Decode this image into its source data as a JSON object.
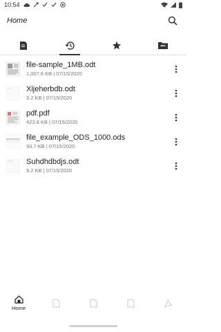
{
  "status_bar": {
    "time": "10:54",
    "icons": [
      "cloud-icon",
      "vpn-key-icon",
      "check-icon",
      "check-icon",
      "circle-a-icon"
    ],
    "right_icons": [
      "wifi-icon",
      "signal-icon",
      "battery-icon"
    ]
  },
  "app_bar": {
    "title": "Home",
    "search_icon": "search-icon"
  },
  "tabs": [
    {
      "name": "tab-browse",
      "icon": "document-icon",
      "active": false
    },
    {
      "name": "tab-recent",
      "icon": "history-icon",
      "active": true
    },
    {
      "name": "tab-favorites",
      "icon": "star-icon",
      "active": false
    },
    {
      "name": "tab-folder",
      "icon": "folder-icon",
      "active": false
    }
  ],
  "files": [
    {
      "name": "file-sample_1MB.odt",
      "meta": "1,007.6 KB | 07/15/2020",
      "thumb": "document-thumbnail"
    },
    {
      "name": "Xijeherbdb.odt",
      "meta": "9.2 KB | 07/15/2020",
      "thumb": "blank-document-thumbnail"
    },
    {
      "name": "pdf.pdf",
      "meta": "423.8 KB | 07/15/2020",
      "thumb": "pdf-thumbnail"
    },
    {
      "name": "file_example_ODS_1000.ods",
      "meta": "93.7 KB | 07/15/2020",
      "thumb": "spreadsheet-thumbnail"
    },
    {
      "name": "Suhdhdbdjs.odt",
      "meta": "9.2 KB | 07/15/2020",
      "thumb": "blank-document-thumbnail"
    }
  ],
  "bottom_nav": [
    {
      "label": "Home",
      "icon": "home-icon",
      "active": true
    },
    {
      "label": "",
      "icon": "document-icon",
      "active": false
    },
    {
      "label": "",
      "icon": "document-icon",
      "active": false
    },
    {
      "label": "",
      "icon": "document-icon",
      "active": false
    },
    {
      "label": "",
      "icon": "pdf-icon",
      "active": false
    }
  ],
  "colors": {
    "accent": "#212121",
    "muted": "#757575",
    "inactive_icon": "#c8c8c8"
  }
}
